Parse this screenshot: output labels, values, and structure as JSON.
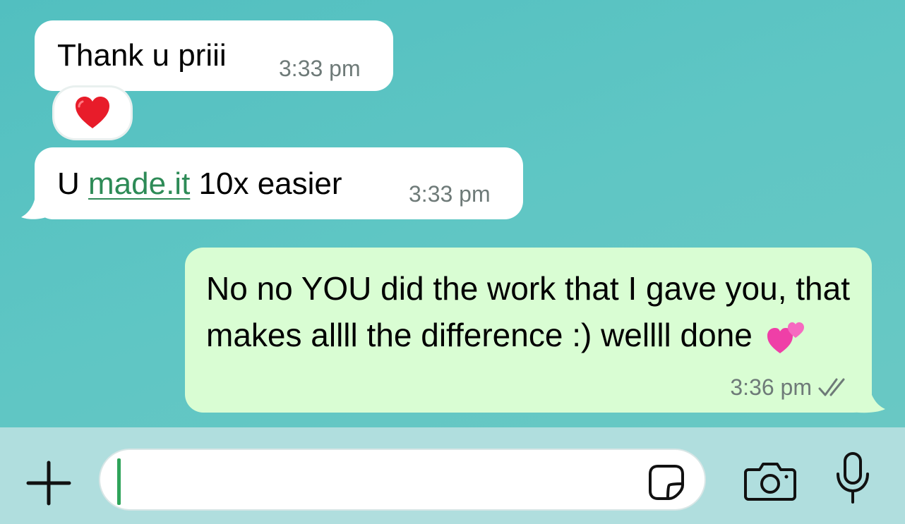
{
  "messages": [
    {
      "direction": "incoming",
      "text": "Thank u priii",
      "time": "3:33 pm",
      "reaction": "heart-emoji"
    },
    {
      "direction": "incoming",
      "text_before": "U ",
      "link": "made.it",
      "text_after": " 10x easier",
      "time": "3:33 pm"
    },
    {
      "direction": "outgoing",
      "text": "No no YOU did the work that I gave you, that makes allll the difference :) wellll done",
      "emoji": "two-hearts-emoji",
      "time": "3:36 pm",
      "status": "read-double-check"
    }
  ],
  "composer": {
    "input_value": "",
    "icons": [
      "plus-icon",
      "sticker-icon",
      "camera-icon",
      "microphone-icon"
    ]
  },
  "colors": {
    "background": "#5fc6c4",
    "incoming_bubble": "#ffffff",
    "outgoing_bubble": "#d9fdd3",
    "link": "#2e8b57",
    "caret": "#2fa35a",
    "composer_bar": "#b0dede"
  }
}
